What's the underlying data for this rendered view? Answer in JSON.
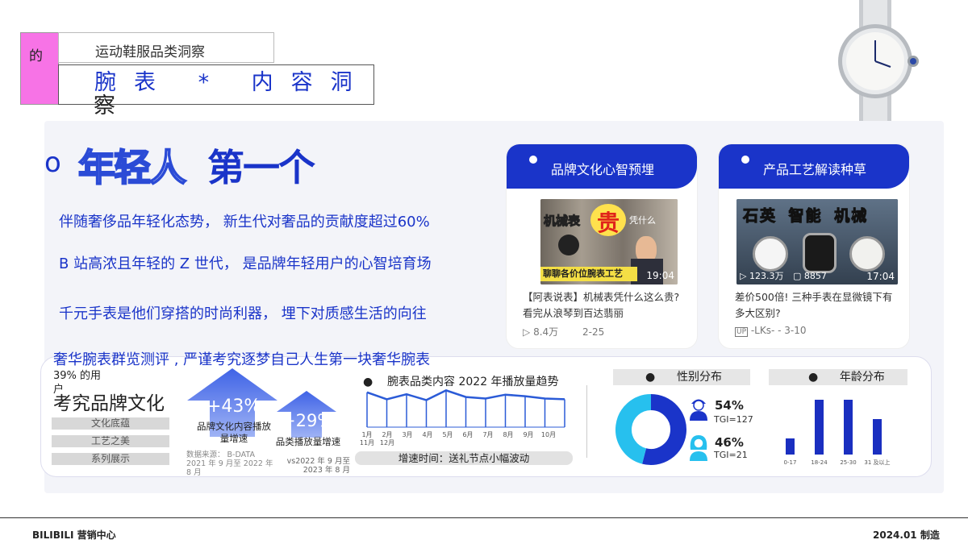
{
  "header": {
    "tag": "的",
    "subtitle": "运动鞋服品类洞察",
    "title": "腕表 * 内容洞",
    "title_wrap": "察"
  },
  "headline": {
    "bullet": "o",
    "outline_text": "年轻人",
    "solid_text": "第一个"
  },
  "paragraphs": [
    "伴随奢侈品年轻化态势， 新生代对奢品的贡献度超过60%",
    "B 站高浓且年轻的 Z 世代， 是品牌年轻用户的心智培育场",
    "千元手表是他们穿搭的时尚利器， 埋下对质感生活的向往"
  ],
  "cards": [
    {
      "header": "品牌文化心智预埋",
      "thumb_title_a": "机械表",
      "thumb_title_b": "贵",
      "thumb_title_c": "凭什么",
      "thumb_tag": "聊聊各价位腕表工艺",
      "duration": "19:04",
      "desc": "【阿表说表】机械表凭什么这么贵?看完从浪琴到百达翡丽",
      "views": "8.4万",
      "date": "2-25"
    },
    {
      "header": "产品工艺解读种草",
      "thumb_words": [
        "石英",
        "智能",
        "机械"
      ],
      "views": "123.3万",
      "comments": "8857",
      "duration": "17:04",
      "desc": "差价500倍! 三种手表在显微镜下有多大区别?",
      "author": "-LKs-",
      "date": "3-10"
    }
  ],
  "bottom": {
    "luxury_line": "奢华腕表群览测评 , 严谨考究逐梦自己人生第一块奢华腕表",
    "pct_label": "39% 的用户",
    "brand_culture": "考究品牌文化",
    "tags": [
      "文化底蕴",
      "工艺之美",
      "系列展示"
    ],
    "growth1_value": "+43%",
    "growth1_label": "品牌文化内容播放量增速",
    "growth2_value": "+29%",
    "growth2_label": "品类播放量增速",
    "source1": "数据来源： B-DATA 2021 年 9 月至 2022 年 8 月",
    "source2": "vs2022 年 9 月至 2023 年 8 月",
    "trend_title": "腕表品类内容 2022 年播放量趋势",
    "trend_note": "增速时间：送礼节点小幅波动",
    "gender_title": "性别分布",
    "male_pct": "54%",
    "male_tgi": "TGI=127",
    "female_pct": "46%",
    "female_tgi": "TGI=21",
    "age_title": "年龄分布"
  },
  "chart_data": [
    {
      "type": "line",
      "title": "腕表品类内容 2022 年播放量趋势",
      "categories": [
        "1月 11月",
        "2月 12月",
        "3月",
        "4月",
        "5月",
        "6月",
        "7月",
        "8月",
        "9月",
        "10月"
      ],
      "values": [
        0.9,
        0.72,
        0.85,
        0.7,
        0.95,
        0.78,
        0.74,
        0.84,
        0.8,
        0.74,
        0.72
      ],
      "ylim": [
        0,
        1
      ],
      "grid": false,
      "color": "#2b5bd7"
    },
    {
      "type": "pie",
      "title": "性别分布",
      "categories": [
        "男",
        "女"
      ],
      "values": [
        54,
        46
      ],
      "colors": [
        "#1a34c9",
        "#27c0ee"
      ]
    },
    {
      "type": "bar",
      "title": "年龄分布",
      "categories": [
        "0-17",
        "18-24",
        "25-30",
        "31 及以上"
      ],
      "values": [
        20,
        68,
        68,
        44
      ],
      "ylim": [
        0,
        70
      ],
      "color": "#1a2fc0"
    }
  ],
  "footer": {
    "left": "BILIBILI 营销中心",
    "right": "2024.01 制造"
  },
  "colors": {
    "accent": "#1a34c9",
    "pink": "#f773e6",
    "cyan": "#27c0ee"
  }
}
